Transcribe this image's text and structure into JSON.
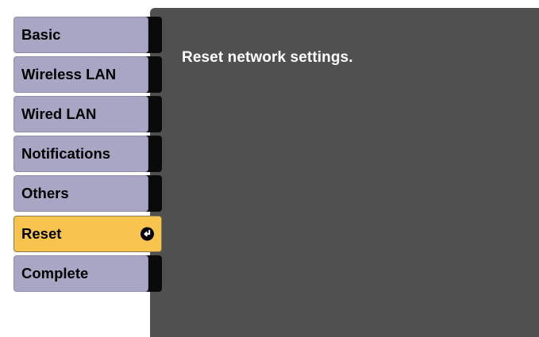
{
  "menu": {
    "items": [
      {
        "label": "Basic"
      },
      {
        "label": "Wireless LAN"
      },
      {
        "label": "Wired LAN"
      },
      {
        "label": "Notifications"
      },
      {
        "label": "Others"
      },
      {
        "label": "Reset",
        "selected": true,
        "icon": "enter-icon"
      },
      {
        "label": "Complete"
      }
    ]
  },
  "panel": {
    "message": "Reset network settings."
  },
  "colors": {
    "menu_item_bg": "#a8a6c4",
    "menu_item_selected_bg": "#f8c44e",
    "panel_bg": "#505050",
    "panel_text": "#ffffff"
  }
}
